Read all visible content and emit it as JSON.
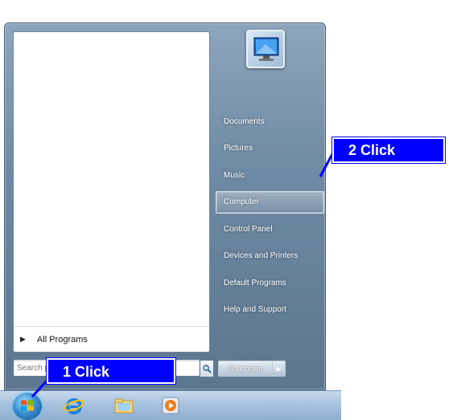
{
  "start_menu": {
    "all_programs_label": "All Programs",
    "search_placeholder": "Search programs and files",
    "right_items": [
      {
        "label": "Documents"
      },
      {
        "label": "Pictures"
      },
      {
        "label": "Music"
      },
      {
        "label": "Computer"
      },
      {
        "label": "Control Panel"
      },
      {
        "label": "Devices and Printers"
      },
      {
        "label": "Default Programs"
      },
      {
        "label": "Help and Support"
      }
    ],
    "shutdown_label": "Shut down"
  },
  "annotations": {
    "step1": "1 Click",
    "step2": "2 Click"
  },
  "colors": {
    "callout_bg": "#0000ff",
    "callout_text": "#ffffff"
  }
}
